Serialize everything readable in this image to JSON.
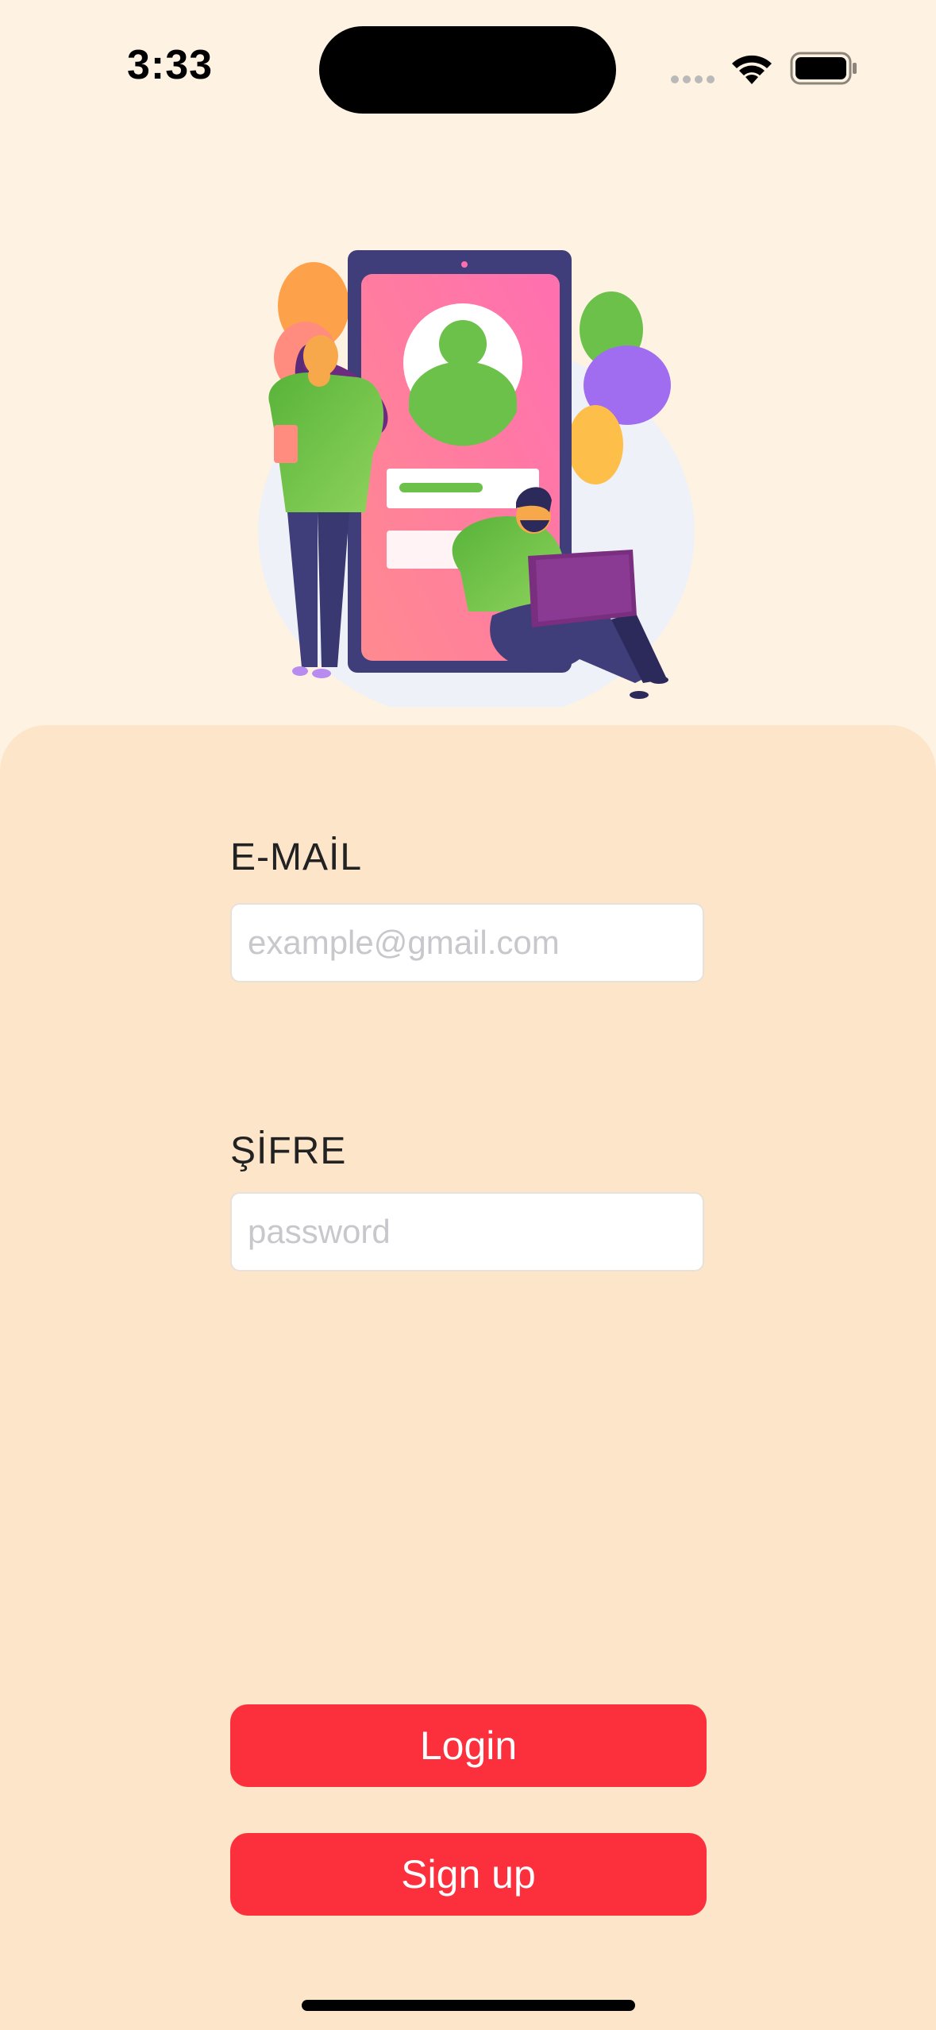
{
  "status_bar": {
    "time": "3:33",
    "wifi_icon": "wifi-icon",
    "battery_icon": "battery-icon",
    "signal_icon": "cellular-signal-icon"
  },
  "illustration": {
    "icon": "login-illustration",
    "accent_colors": [
      "#FC6DA8",
      "#6BC14A",
      "#3F3D7A",
      "#A06CF0",
      "#FDB94A"
    ]
  },
  "form": {
    "email_label": "E-MAİL",
    "email_placeholder": "example@gmail.com",
    "email_value": "",
    "password_label": "ŞİFRE",
    "password_placeholder": "password",
    "password_value": ""
  },
  "buttons": {
    "login_label": "Login",
    "signup_label": "Sign up",
    "color": "#FC2F3C"
  },
  "theme": {
    "background": "#FEF2E2",
    "panel": "#FDE5CA"
  }
}
